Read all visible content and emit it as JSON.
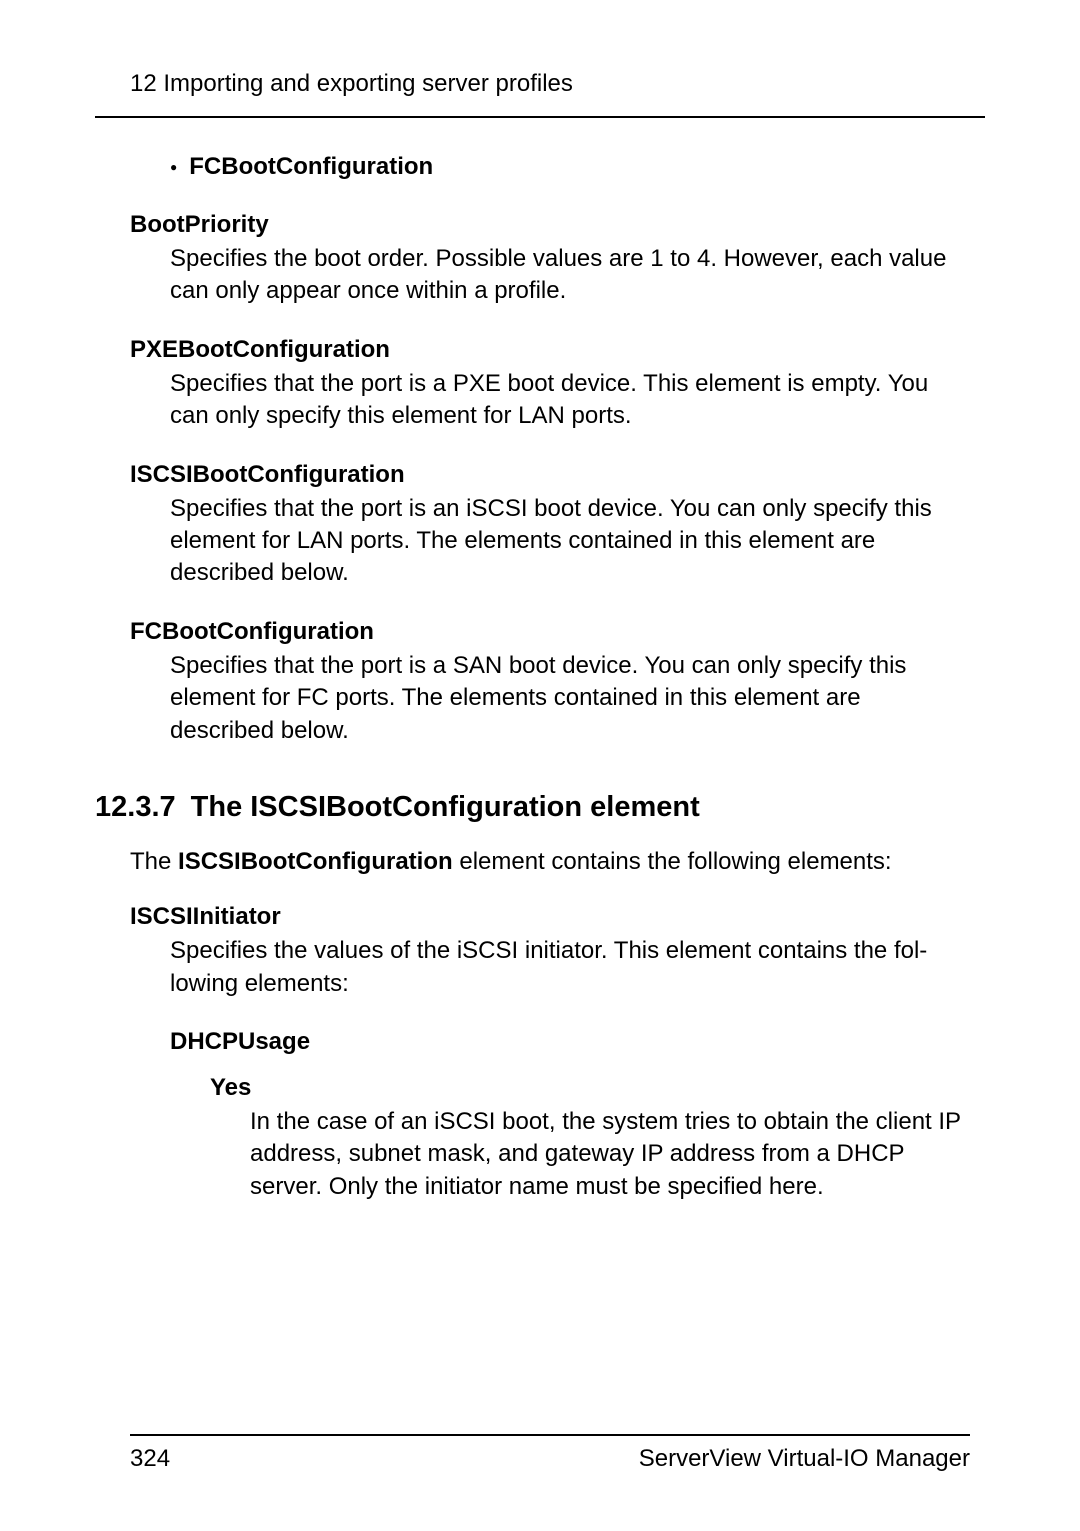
{
  "header": {
    "chapter_title": "12 Importing and exporting server profiles"
  },
  "bullet": {
    "label": "FCBootConfiguration"
  },
  "definitions": [
    {
      "term": "BootPriority",
      "desc": "Specifies the boot order. Possible values are 1 to 4. However, each value can only appear once within a profile."
    },
    {
      "term": "PXEBootConfiguration",
      "desc": "Specifies that the port is a PXE boot device. This element is empty. You can only specify this element for LAN ports."
    },
    {
      "term": "ISCSIBootConfiguration",
      "desc": "Specifies that the port is an iSCSI boot device. You can only specify this element for LAN ports. The elements contained in this element are described below."
    },
    {
      "term": "FCBootConfiguration",
      "desc": "Specifies that the port is a SAN boot device. You can only specify this element for FC ports. The elements contained in this element are described below."
    }
  ],
  "section": {
    "number": "12.3.7",
    "title": "The ISCSIBootConfiguration element",
    "intro_prefix": "The ",
    "intro_bold": "ISCSIBootConfiguration",
    "intro_suffix": " element contains the following elements:"
  },
  "sub_definition": {
    "term": "ISCSIInitiator",
    "desc": "Specifies the values of the iSCSI initiator. This element contains the fol­lowing elements:"
  },
  "nested": {
    "term": "DHCPUsage",
    "sub_term": "Yes",
    "sub_desc": "In the case of an iSCSI boot, the system tries to obtain the client IP address, subnet mask, and gateway IP address from a DHCP server. Only the initiator name must be specified here."
  },
  "footer": {
    "page_number": "324",
    "product_name": "ServerView Virtual-IO Manager"
  }
}
